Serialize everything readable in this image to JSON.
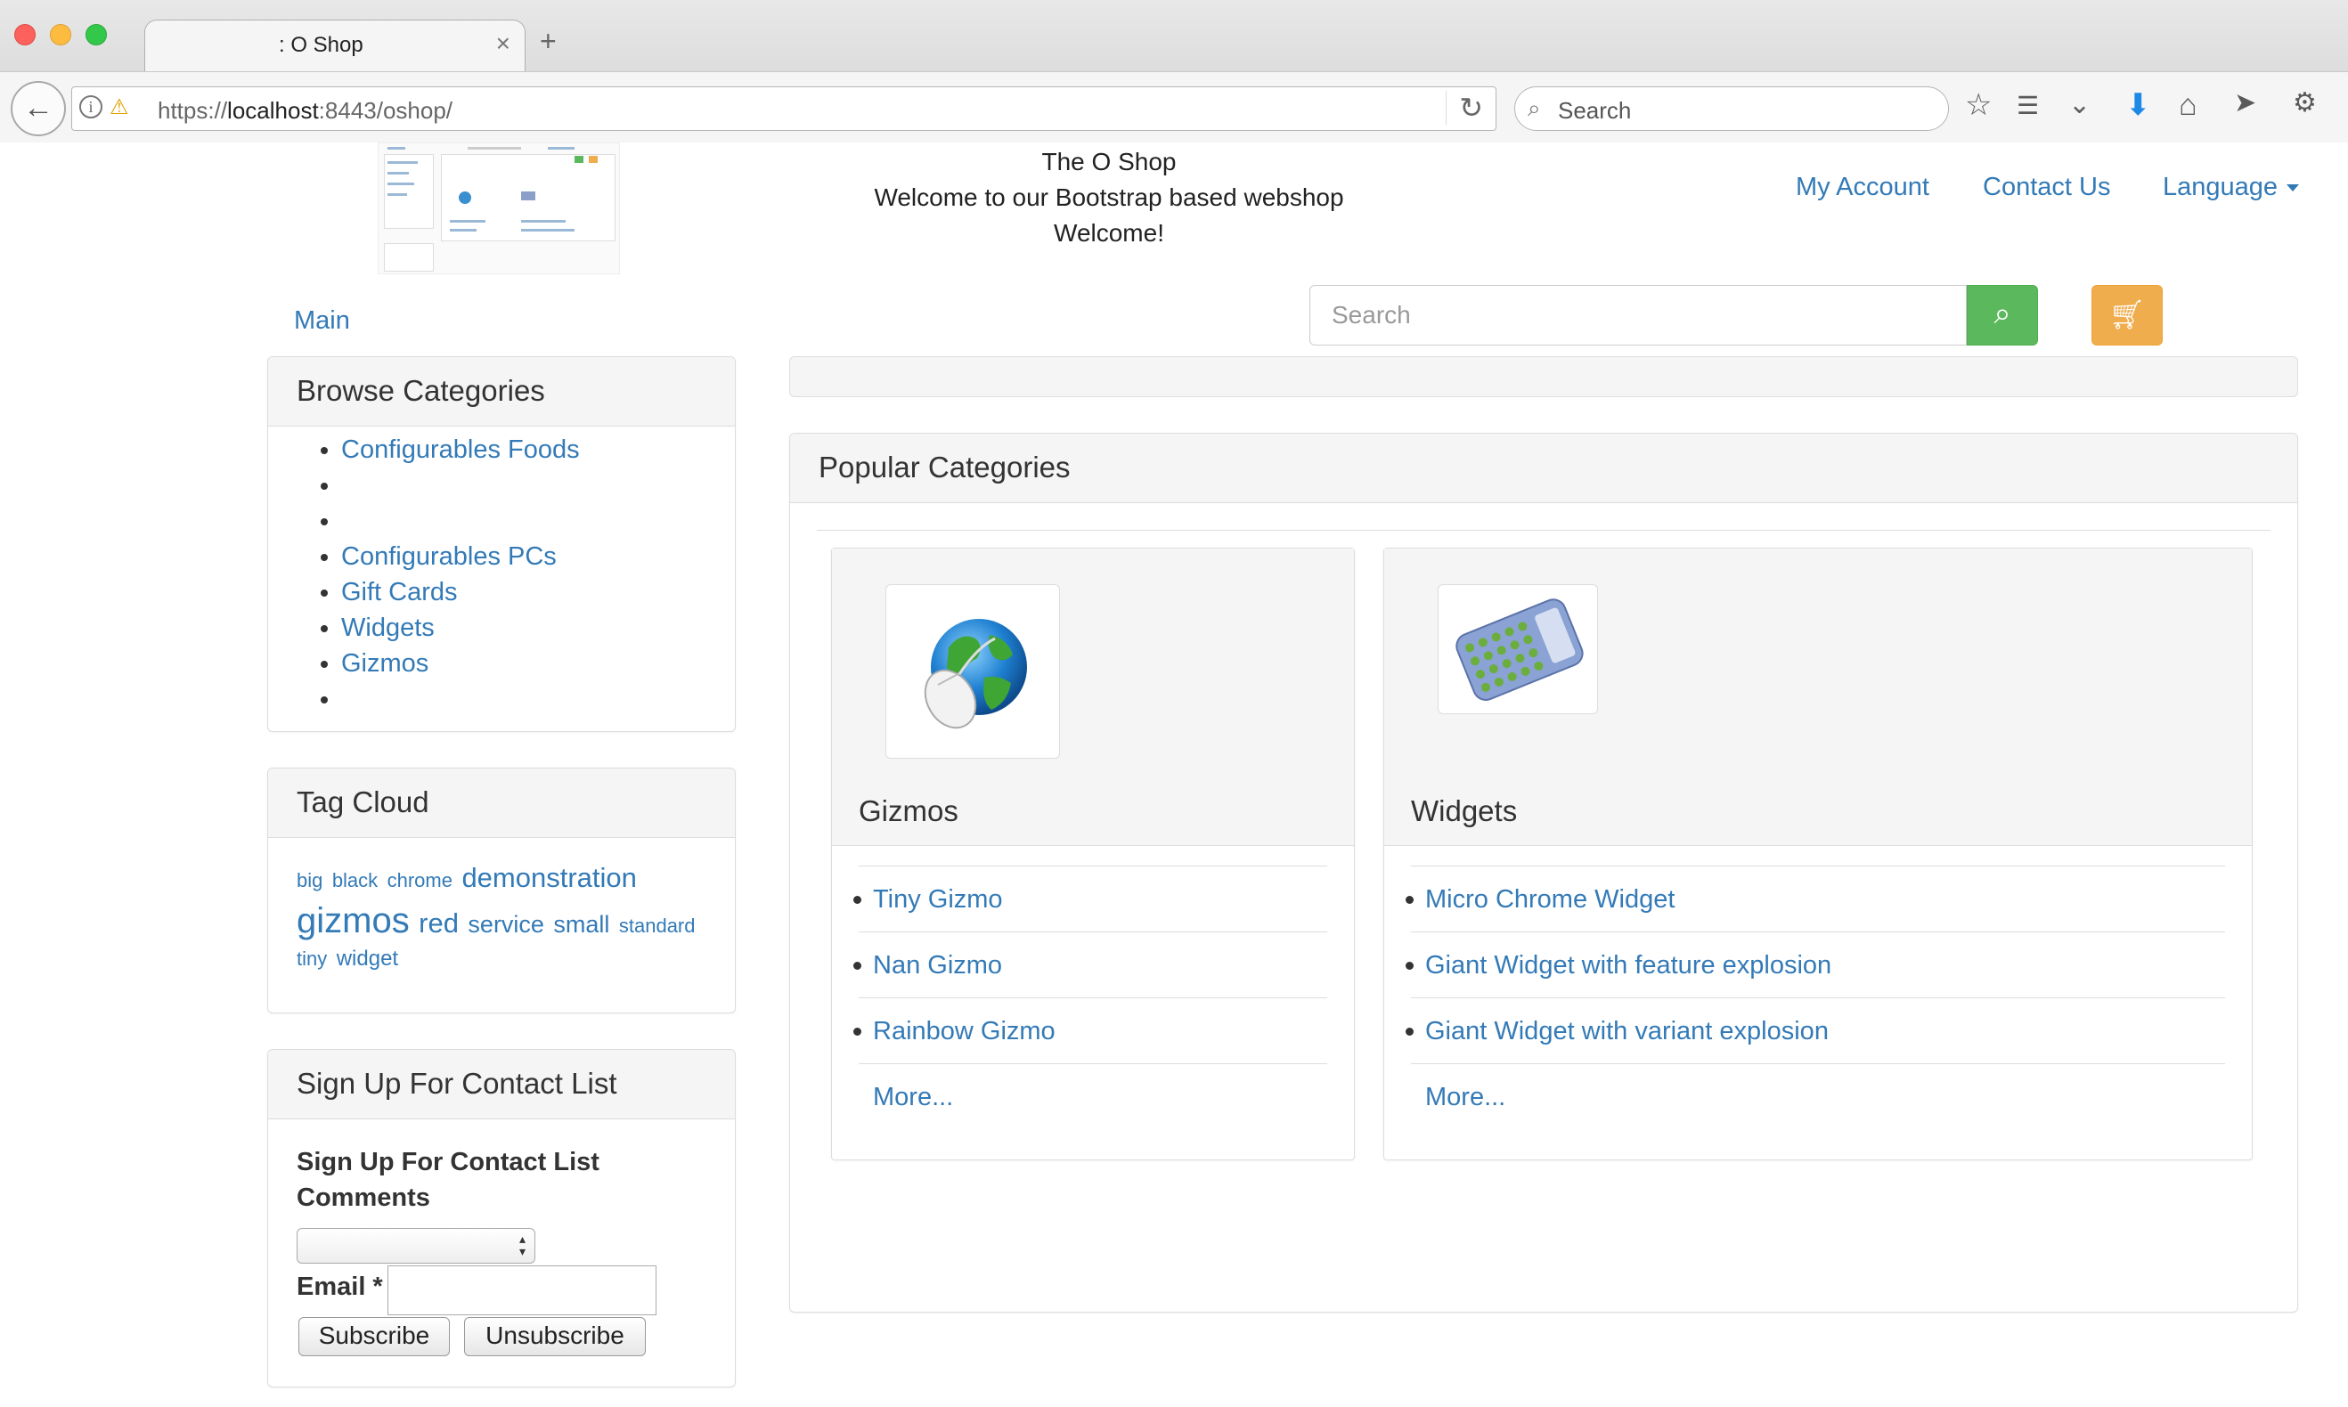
{
  "browser": {
    "tab_title": ": O Shop",
    "tab_close": "×",
    "new_tab": "+",
    "url_scheme": "https://",
    "url_host": "localhost",
    "url_rest": ":8443/oshop/",
    "search_placeholder": "Search",
    "icons": [
      "back-icon",
      "info-icon",
      "insecure-lock-icon",
      "reload-icon",
      "search-icon",
      "bookmark-star-icon",
      "reading-list-icon",
      "pocket-icon",
      "download-icon",
      "home-icon",
      "send-icon",
      "bug-icon"
    ]
  },
  "header": {
    "shop_name": "The O Shop",
    "tagline": "Welcome to our Bootstrap based webshop",
    "welcome": "Welcome!",
    "nav": {
      "my_account": "My Account",
      "contact_us": "Contact Us",
      "language": "Language"
    },
    "search_placeholder": "Search"
  },
  "breadcrumb": {
    "main": "Main"
  },
  "sidebar": {
    "browse": {
      "title": "Browse Categories",
      "items": [
        "Configurables Foods",
        "",
        "",
        "Configurables PCs",
        "Gift Cards",
        "Widgets",
        "Gizmos",
        ""
      ]
    },
    "tag_cloud": {
      "title": "Tag Cloud",
      "tags": [
        {
          "label": "big",
          "size": 22
        },
        {
          "label": "black",
          "size": 22
        },
        {
          "label": "chrome",
          "size": 22
        },
        {
          "label": "demonstration",
          "size": 31
        },
        {
          "label": "gizmos",
          "size": 40
        },
        {
          "label": "red",
          "size": 31
        },
        {
          "label": "service",
          "size": 27
        },
        {
          "label": "small",
          "size": 27
        },
        {
          "label": "standard",
          "size": 22
        },
        {
          "label": "tiny",
          "size": 22
        },
        {
          "label": "widget",
          "size": 24
        }
      ]
    },
    "signup": {
      "title": "Sign Up For Contact List",
      "heading": "Sign Up For Contact List",
      "comments_label": "Comments",
      "email_label": "Email *",
      "subscribe": "Subscribe",
      "unsubscribe": "Unsubscribe"
    }
  },
  "popular": {
    "title": "Popular Categories",
    "categories": [
      {
        "name": "Gizmos",
        "icon": "globe-mouse-icon",
        "items": [
          "Tiny Gizmo",
          "Nan Gizmo",
          "Rainbow Gizmo"
        ],
        "more": "More..."
      },
      {
        "name": "Widgets",
        "icon": "calculator-icon",
        "items": [
          "Micro Chrome Widget",
          "Giant Widget with feature explosion",
          "Giant Widget with variant explosion"
        ],
        "more": "More..."
      }
    ]
  },
  "colors": {
    "link": "#337ab7",
    "search_button": "#5cb85c",
    "cart_button": "#f0ad4e",
    "panel_heading": "#f5f5f5"
  }
}
